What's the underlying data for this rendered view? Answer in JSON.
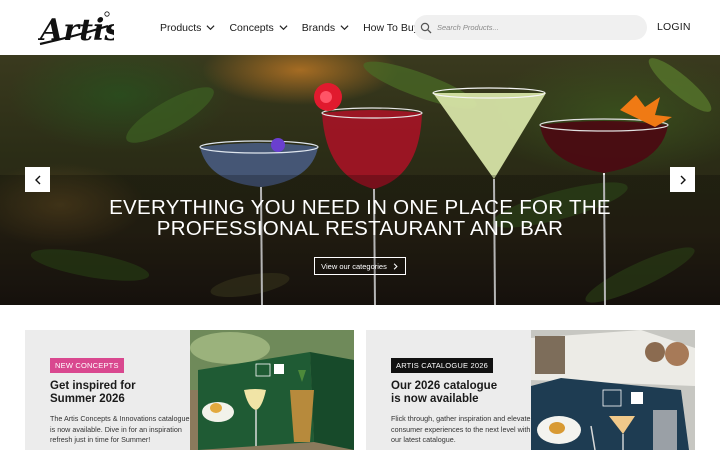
{
  "header": {
    "logo_text": "Artis",
    "nav": [
      {
        "label": "Products",
        "has_dropdown": true
      },
      {
        "label": "Concepts",
        "has_dropdown": true
      },
      {
        "label": "Brands",
        "has_dropdown": true
      },
      {
        "label": "How To Buy",
        "has_dropdown": false
      }
    ],
    "search": {
      "placeholder": "Search Products...",
      "icon": "search-icon"
    },
    "login_label": "LOGIN"
  },
  "hero": {
    "title_line1": "EVERYTHING YOU NEED IN ONE PLACE FOR THE",
    "title_line2": "PROFESSIONAL RESTAURANT AND BAR",
    "cta_label": "View our categories",
    "prev_icon": "chevron-left-icon",
    "next_icon": "chevron-right-icon"
  },
  "cards": [
    {
      "tag": "NEW CONCEPTS",
      "tag_color": "#d9488f",
      "title_line1": "Get inspired for",
      "title_line2": "Summer 2026",
      "body": "The Artis Concepts & Innovations catalogue is now available. Dive in for an inspiration refresh just in time for Summer!"
    },
    {
      "tag": "ARTIS CATALOGUE 2026",
      "tag_color": "#111111",
      "title_line1": "Our 2026 catalogue",
      "title_line2": "is now available",
      "body": "Flick through, gather inspiration and elevate consumer experiences to the next level with our latest catalogue."
    }
  ]
}
